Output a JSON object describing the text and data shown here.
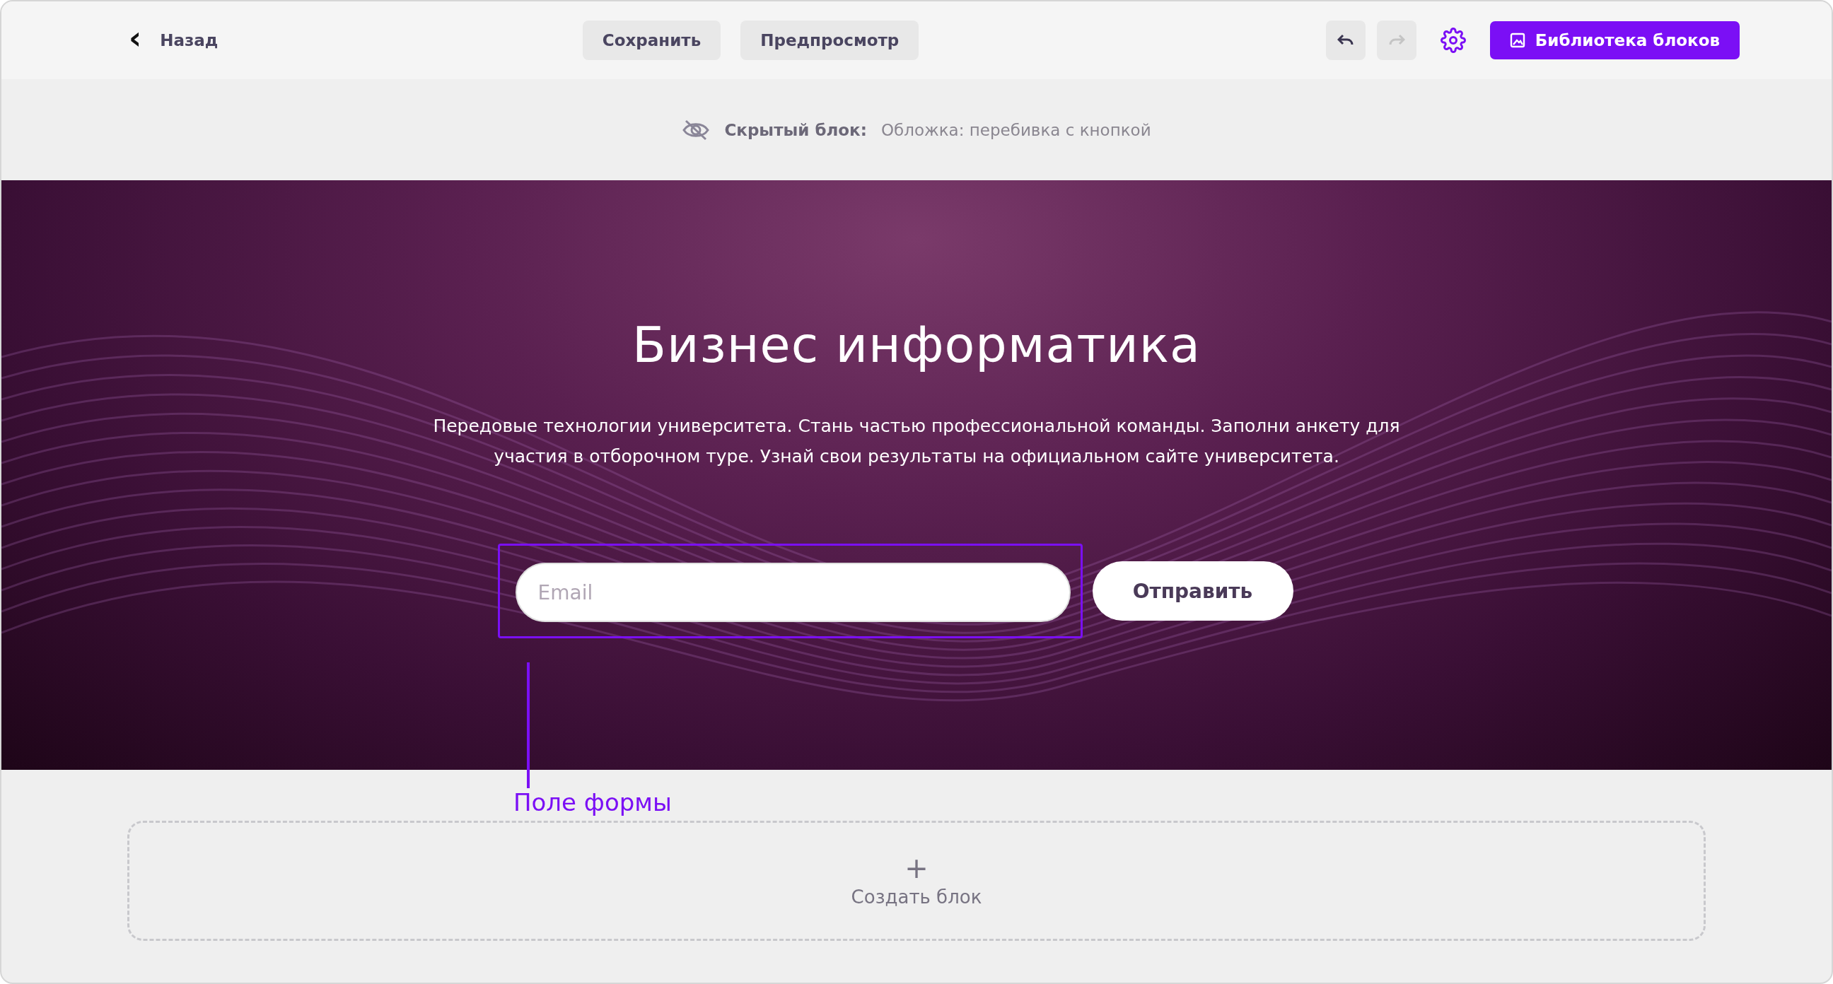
{
  "toolbar": {
    "back": {
      "icon": "‹",
      "label": "Назад"
    },
    "actions": [
      {
        "label": "Сохранить"
      },
      {
        "label": "Предпросмотр"
      }
    ],
    "history": [
      {
        "kind": "undo",
        "disabled": false
      },
      {
        "kind": "redo",
        "disabled": true
      }
    ],
    "library_button": {
      "label": "Библиотека блоков"
    }
  },
  "hidden_notice": {
    "label": "Скрытый блок:",
    "value": "Обложка: перебивка с кнопкой"
  },
  "hero": {
    "title": "Бизнес информатика",
    "description": "Передовые технологии университета. Стань частью профессиональной команды. Заполни анкету для участия в отборочном туре. Узнай свои результаты на официальном сайте университета.",
    "form": {
      "placeholder": "Email",
      "submit": "Отправить",
      "highlighted": true
    }
  },
  "annotation": {
    "label": "Поле формы"
  },
  "create_block": {
    "icon": "+",
    "label": "Создать блок"
  }
}
